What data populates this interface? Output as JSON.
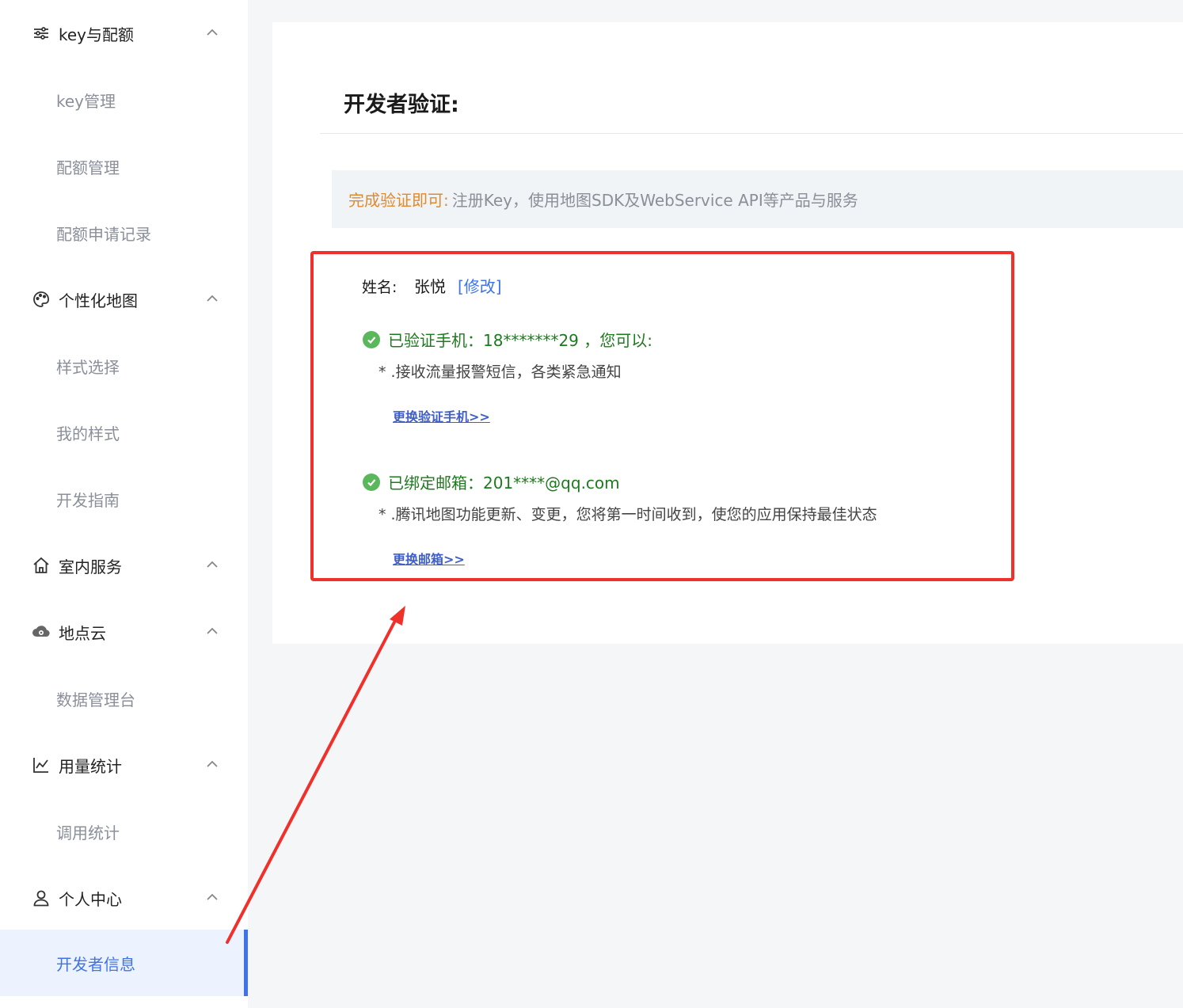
{
  "sidebar": {
    "groups": [
      {
        "label": "key与配额",
        "icon": "sliders-icon"
      },
      {
        "label": "个性化地图",
        "icon": "palette-icon"
      },
      {
        "label": "室内服务",
        "icon": "home-icon"
      },
      {
        "label": "地点云",
        "icon": "cloud-eye-icon"
      },
      {
        "label": "用量统计",
        "icon": "line-chart-icon"
      },
      {
        "label": "个人中心",
        "icon": "user-icon"
      }
    ],
    "items": {
      "key_manage": "key管理",
      "quota_manage": "配额管理",
      "quota_records": "配额申请记录",
      "style_select": "样式选择",
      "my_styles": "我的样式",
      "dev_guide": "开发指南",
      "data_console": "数据管理台",
      "call_stats": "调用统计",
      "developer_info": "开发者信息"
    }
  },
  "main": {
    "title": "开发者验证:",
    "notice": {
      "lead": "完成验证即可:",
      "text": "注册Key，使用地图SDK及WebService API等产品与服务"
    },
    "name": {
      "label": "姓名:",
      "value": "张悦",
      "edit": "[修改]"
    },
    "phone": {
      "status": "已验证手机：18*******29 ，您可以:",
      "desc": "* .接收流量报警短信，各类紧急通知",
      "change": "更换验证手机>>"
    },
    "email": {
      "status": "已绑定邮箱：201****@qq.com",
      "desc": "* .腾讯地图功能更新、变更，您将第一时间收到，使您的应用保持最佳状态",
      "change": "更换邮箱>>"
    }
  },
  "colors": {
    "accent": "#3f74e8",
    "success": "#1e7a1e",
    "warning": "#e08a2e",
    "annotation": "#f0302a"
  }
}
